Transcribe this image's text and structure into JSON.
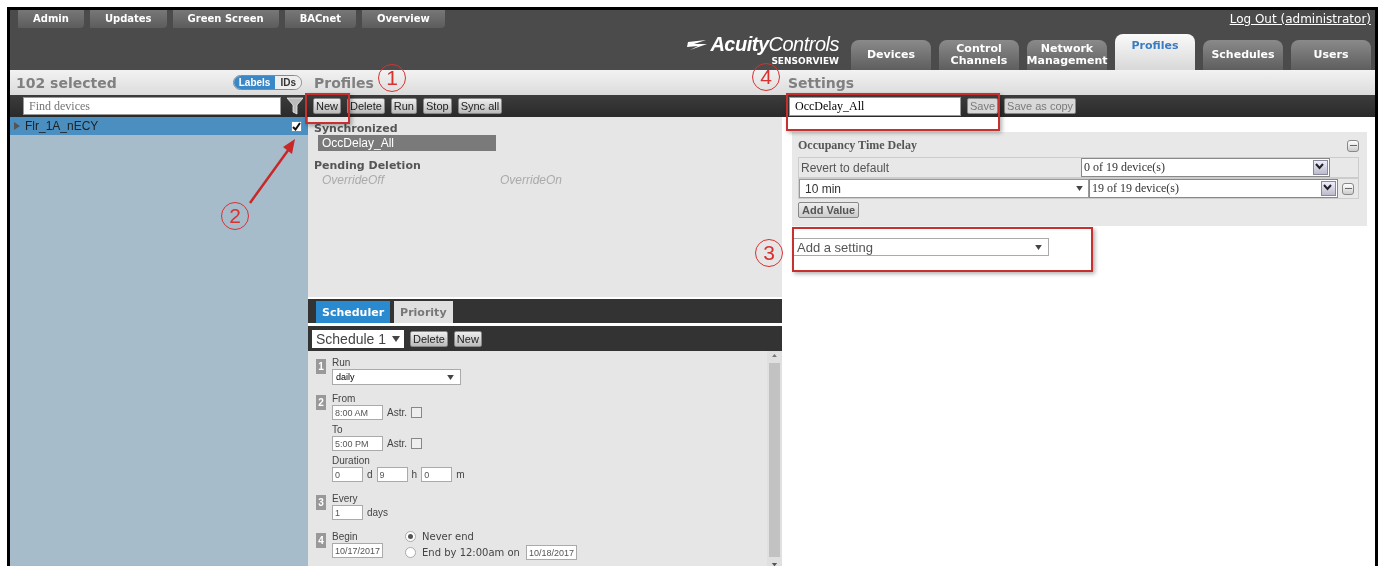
{
  "top_nav": [
    {
      "label": "Admin"
    },
    {
      "label": "Updates"
    },
    {
      "label": "Green Screen"
    },
    {
      "label": "BACnet"
    },
    {
      "label": "Overview"
    }
  ],
  "logout": "Log Out (administrator)",
  "logo": {
    "bold": "Acuity",
    "light": "Controls",
    "sub": "SENSORVIEW"
  },
  "main_tabs": [
    {
      "label": "Devices",
      "selected": false
    },
    {
      "label": "Control Channels",
      "selected": false
    },
    {
      "label": "Network Management",
      "selected": false
    },
    {
      "label": "Profiles",
      "selected": true
    },
    {
      "label": "Schedules",
      "selected": false
    },
    {
      "label": "Users",
      "selected": false
    }
  ],
  "devices_panel": {
    "title": "102 selected",
    "view_toggle": [
      {
        "label": "Labels",
        "selected": true
      },
      {
        "label": "IDs",
        "selected": false
      }
    ],
    "search": {
      "placeholder": "Find devices"
    },
    "items": [
      {
        "label": "Flr_1A_nECY",
        "selected": true,
        "checked": true,
        "expanded": false
      }
    ]
  },
  "profiles_panel": {
    "title": "Profiles",
    "buttons": [
      "New",
      "Delete",
      "Run",
      "Stop",
      "Sync all"
    ],
    "groups": [
      {
        "kind": "synced",
        "heading": "Synchronized",
        "items": [
          {
            "label": "OccDelay_All",
            "selected": true
          }
        ]
      },
      {
        "kind": "pending",
        "heading": "Pending Deletion",
        "items": [
          {
            "label": "OverrideOff",
            "selected": false
          },
          {
            "label": "OverrideOn",
            "selected": false
          }
        ]
      }
    ]
  },
  "scheduler": {
    "tabs": [
      {
        "label": "Scheduler",
        "selected": true
      },
      {
        "label": "Priority",
        "selected": false
      }
    ],
    "schedule_select": "Schedule 1",
    "buttons": [
      "Delete",
      "New"
    ],
    "run": {
      "number": "1",
      "label": "Run",
      "value": "daily"
    },
    "times": {
      "number": "2",
      "from_label": "From",
      "from": "8:00 AM",
      "to_label": "To",
      "to": "5:00 PM",
      "from_astro_label": "Astr.",
      "to_astro_label": "Astr.",
      "from_astro": false,
      "to_astro": false,
      "duration_label": "Duration",
      "duration": [
        {
          "value": "0",
          "unit": "d"
        },
        {
          "value": "9",
          "unit": "h"
        },
        {
          "value": "0",
          "unit": "m"
        }
      ]
    },
    "every": {
      "number": "3",
      "label": "Every",
      "value": "1",
      "unit": "days"
    },
    "begin": {
      "number": "4",
      "label": "Begin",
      "value": "10/17/2017",
      "end_options": [
        {
          "label": "Never end",
          "selected": true
        },
        {
          "label": "End by 12:00am on",
          "selected": false,
          "date": "10/18/2017"
        }
      ]
    }
  },
  "settings_panel": {
    "title": "Settings",
    "name_field": "OccDelay_All",
    "buttons": [
      {
        "label": "Save",
        "disabled": true
      },
      {
        "label": "Save as copy",
        "disabled": true
      }
    ],
    "cards": [
      {
        "title": "Occupancy Time Delay",
        "rows": [
          {
            "kind": "default",
            "label": "Revert to default",
            "devices": "0 of 19 device(s)"
          },
          {
            "kind": "value",
            "value": "10 min",
            "devices": "19 of 19 device(s)"
          }
        ],
        "add_button": "Add Value"
      }
    ],
    "add_setting": {
      "placeholder": "Add a setting"
    }
  },
  "annotations": [
    {
      "label": "1"
    },
    {
      "label": "2"
    },
    {
      "label": "3"
    },
    {
      "label": "4"
    }
  ]
}
